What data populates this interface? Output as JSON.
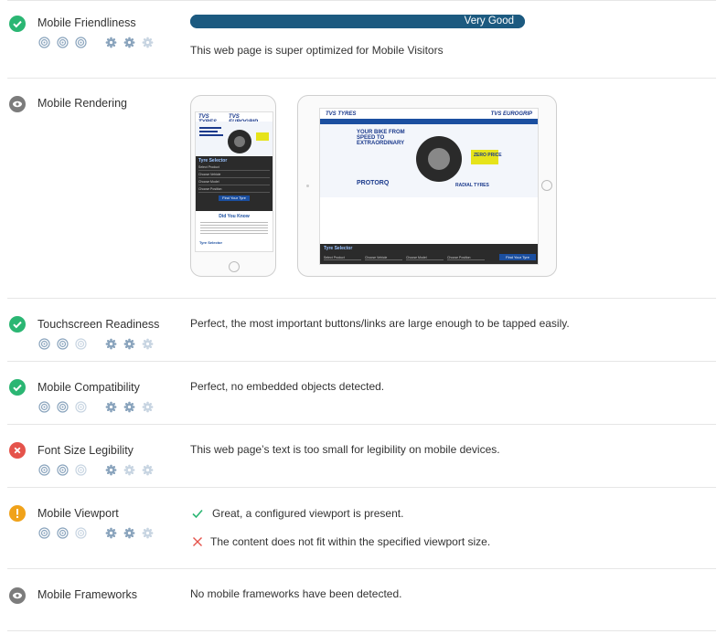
{
  "rows": {
    "friendliness": {
      "label": "Mobile Friendliness",
      "status": "pass",
      "bar_label": "Very Good",
      "bar_level": 1.0,
      "text": "This web page is super optimized for Mobile Visitors"
    },
    "rendering": {
      "label": "Mobile Rendering",
      "status": "info",
      "phone_preview": {
        "logo": "TVS TYRES",
        "brand": "TVS EUROGRIP",
        "panel_title": "Tyre Selector",
        "fields": [
          "Select Product",
          "Choose Vehicle",
          "Choose Model",
          "Choose Position"
        ],
        "button": "Find Your Tyre",
        "heading": "Did You Know",
        "link": "Tyre Selector"
      },
      "tablet_preview": {
        "logo": "TVS TYRES",
        "brand": "TVS EUROGRIP",
        "headline": "YOUR BIKE FROM SPEED TO EXTRAORDINARY",
        "product": "PROTORQ",
        "promo": "ZERO PRICE",
        "tagline": "RADIAL TYRES",
        "panel_title": "Tyre Selector",
        "fields": [
          "Select Product",
          "Choose Vehicle",
          "Choose Model",
          "Choose Position"
        ],
        "button": "Find Your Tyre"
      }
    },
    "touchscreen": {
      "label": "Touchscreen Readiness",
      "status": "pass",
      "text": "Perfect, the most important buttons/links are large enough to be tapped easily."
    },
    "compatibility": {
      "label": "Mobile Compatibility",
      "status": "pass",
      "text": "Perfect, no embedded objects detected."
    },
    "font_size": {
      "label": "Font Size Legibility",
      "status": "fail",
      "text": "This web page’s text is too small for legibility on mobile devices."
    },
    "viewport": {
      "label": "Mobile Viewport",
      "status": "warning",
      "ok_text": "Great, a configured viewport is present.",
      "fail_text": "The content does not fit within the specified viewport size."
    },
    "frameworks": {
      "label": "Mobile Frameworks",
      "status": "info",
      "text": "No mobile frameworks have been detected."
    }
  },
  "icon_sets": {
    "friendliness": [
      "target-icon",
      "target-icon",
      "target-icon",
      "gear-icon",
      "gear-icon",
      "gear-icon-light"
    ],
    "touchscreen": [
      "target-icon",
      "target-icon",
      "target-icon-light",
      "gear-icon",
      "gear-icon",
      "gear-icon-light"
    ],
    "compatibility": [
      "target-icon",
      "target-icon",
      "target-icon-light",
      "gear-icon",
      "gear-icon",
      "gear-icon-light"
    ],
    "font_size": [
      "target-icon",
      "target-icon",
      "target-icon-light",
      "gear-icon",
      "gear-icon-light",
      "gear-icon-light"
    ],
    "viewport": [
      "target-icon",
      "target-icon",
      "target-icon-light",
      "gear-icon",
      "gear-icon",
      "gear-icon-light"
    ]
  },
  "colors": {
    "pass": "#2bb673",
    "fail": "#e5534b",
    "warning": "#f0a21a",
    "info": "#7c7c7c",
    "bar": "#1c5a80",
    "icon": "#8aa4bd",
    "icon_light": "#c8d5e2"
  }
}
